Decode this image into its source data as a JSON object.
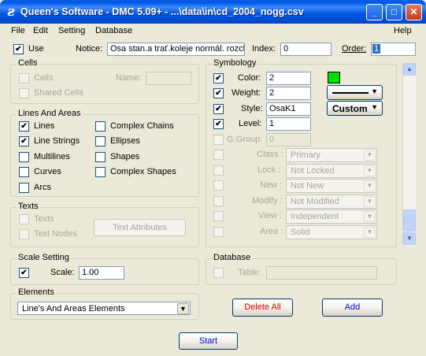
{
  "window": {
    "title": "Queen's Software - DMC 5.09+ - ...\\data\\in\\cd_2004_nogg.csv",
    "minimize": "_",
    "maximize": "□",
    "close": "✕"
  },
  "menu": {
    "file": "File",
    "edit": "Edit",
    "setting": "Setting",
    "database": "Database",
    "help": "Help"
  },
  "top": {
    "use_label": "Use",
    "use_checked": true,
    "notice_label": "Notice:",
    "notice_value": "Osa stan.a trať.koleje normál. rozch",
    "index_label": "Index:",
    "index_value": "0",
    "order_label": "Order:",
    "order_value": "1"
  },
  "cells": {
    "title": "Cells",
    "cells_label": "Cells",
    "shared_cells_label": "Shared Cells",
    "name_label": "Name:",
    "name_value": ""
  },
  "lines_areas": {
    "title": "Lines And Areas",
    "items": [
      {
        "label": "Lines",
        "checked": true
      },
      {
        "label": "Line Strings",
        "checked": true
      },
      {
        "label": "Multilines",
        "checked": false
      },
      {
        "label": "Curves",
        "checked": false
      },
      {
        "label": "Arcs",
        "checked": false
      },
      {
        "label": "Complex Chains",
        "checked": false
      },
      {
        "label": "Ellipses",
        "checked": false
      },
      {
        "label": "Shapes",
        "checked": false
      },
      {
        "label": "Complex Shapes",
        "checked": false
      }
    ]
  },
  "texts": {
    "title": "Texts",
    "texts_label": "Texts",
    "text_nodes_label": "Text Nodes",
    "text_attributes_button": "Text Attributes"
  },
  "symbology": {
    "title": "Symbology",
    "color_label": "Color:",
    "color_value": "2",
    "color_swatch": "#00E000",
    "weight_label": "Weight:",
    "weight_value": "2",
    "style_label": "Style:",
    "style_value": "OsaK1",
    "level_label": "Level:",
    "level_value": "1",
    "ggroup_label": "G.Group:",
    "ggroup_value": "0",
    "custom_label": "Custom",
    "class_label": "Class :",
    "class_value": "Primary",
    "lock_label": "Lock :",
    "lock_value": "Not Locked",
    "new_label": "New :",
    "new_value": "Not New",
    "modify_label": "Modify :",
    "modify_value": "Not Modified",
    "view_label": "View :",
    "view_value": "Independent",
    "area_label": "Area :",
    "area_value": "Solid"
  },
  "scale": {
    "title": "Scale Setting",
    "scale_label": "Scale:",
    "scale_value": "1.00",
    "checked": true
  },
  "database": {
    "title": "Database",
    "table_label": "Table:",
    "table_value": ""
  },
  "elements": {
    "title": "Elements",
    "selected": "Line's And Areas Elements"
  },
  "buttons": {
    "delete_all": "Delete All",
    "add": "Add",
    "start": "Start"
  },
  "colors": {
    "titlebar": "#0054E3",
    "window_bg": "#ECE9D8",
    "delete_text": "#E00000",
    "add_text": "#0000E0"
  }
}
